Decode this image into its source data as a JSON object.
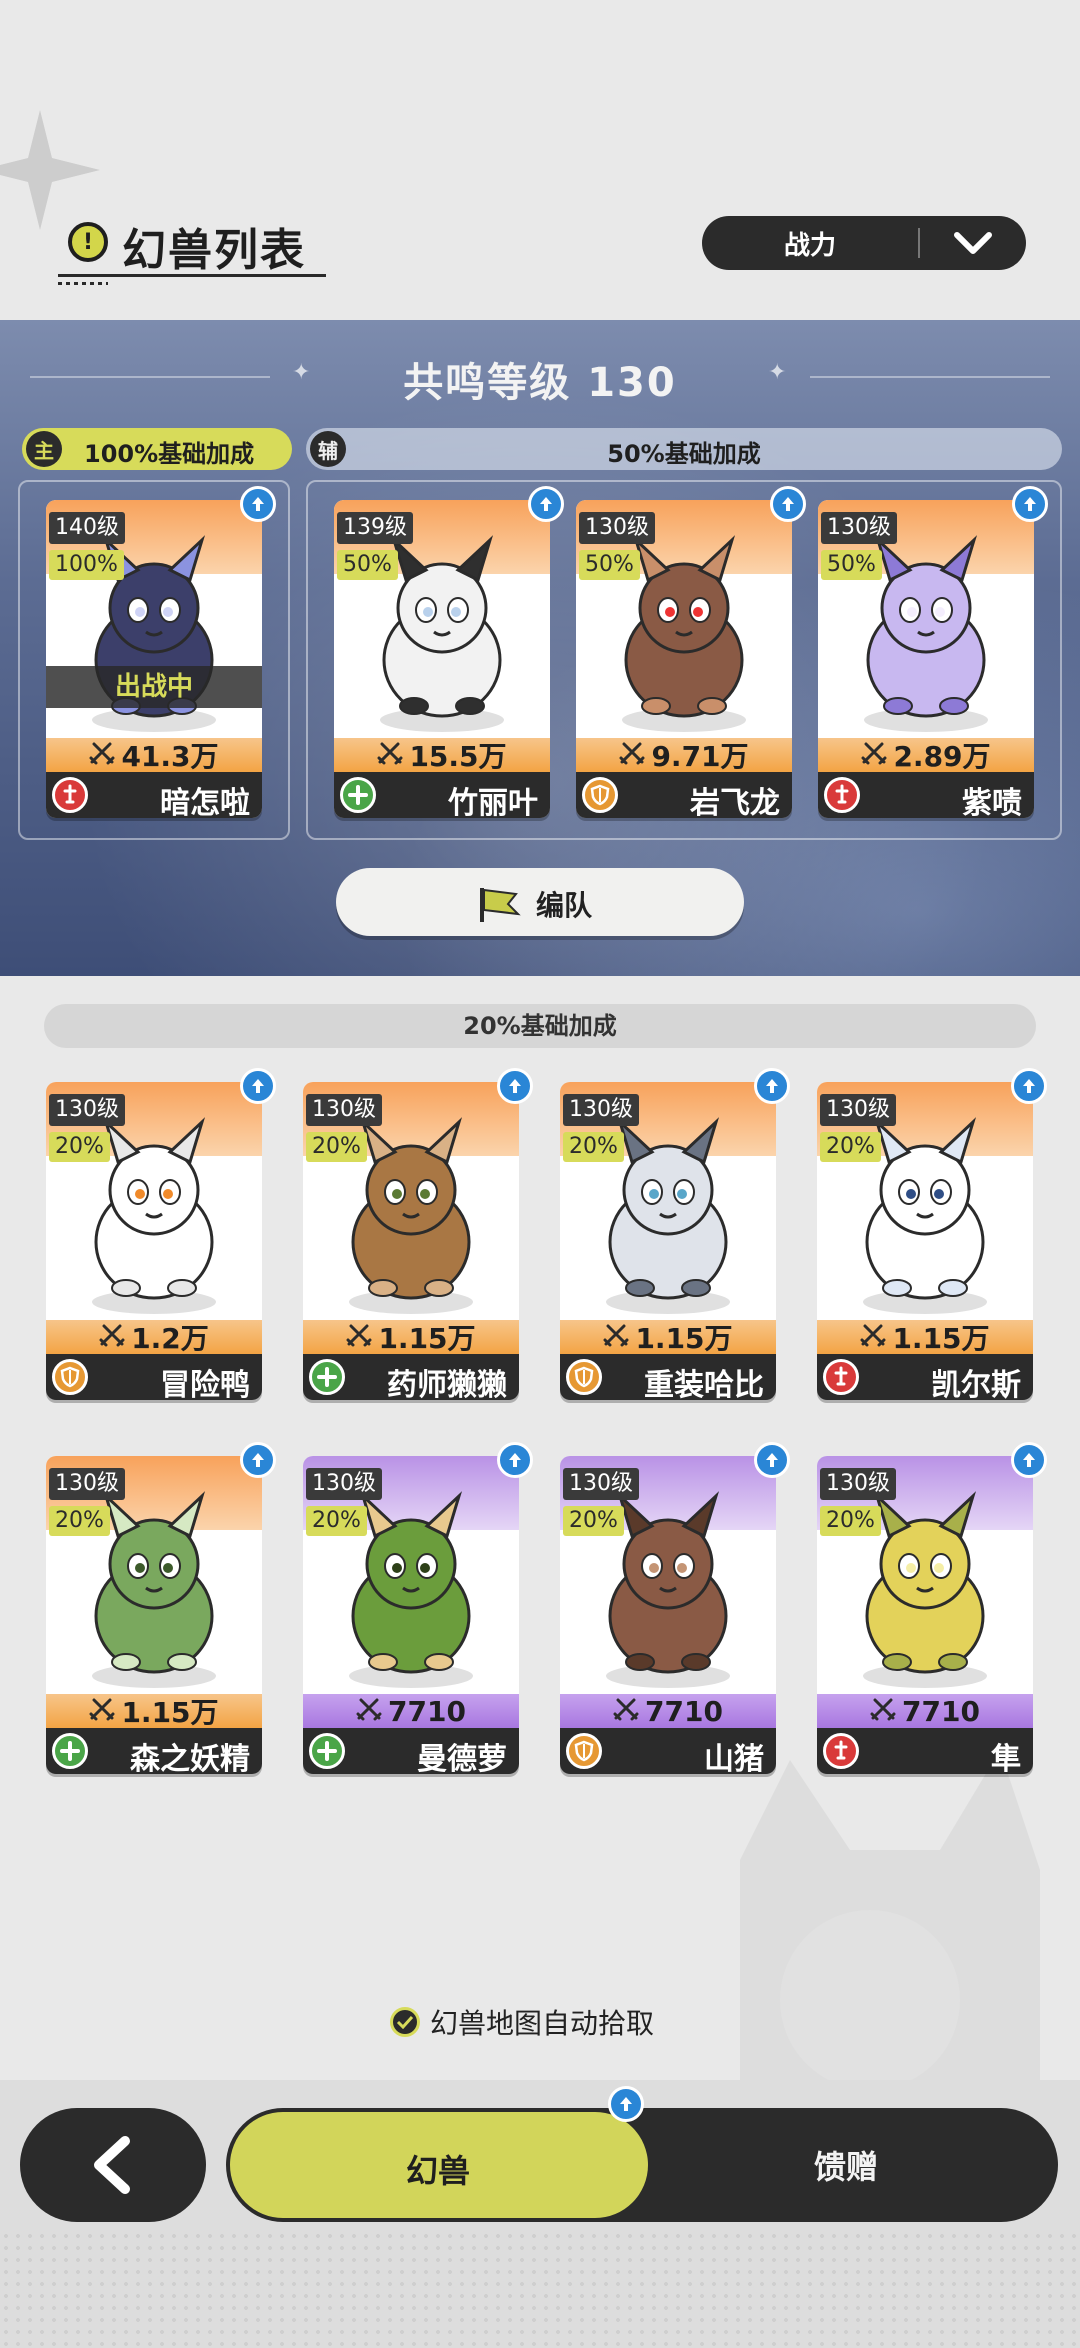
{
  "header": {
    "title": "幻兽列表",
    "sort_label": "战力"
  },
  "resonance": {
    "title": "共鸣等级 130",
    "main_badge": "主",
    "main_bonus": "100%基础加成",
    "support_badge": "辅",
    "support_bonus": "50%基础加成",
    "deploy_label": "编队"
  },
  "team_cards": [
    {
      "level": "140级",
      "pct": "100%",
      "power": "41.3万",
      "name": "暗怎啦",
      "role": "attack",
      "status": "出战中",
      "theme": "orange"
    },
    {
      "level": "139级",
      "pct": "50%",
      "power": "15.5万",
      "name": "竹丽叶",
      "role": "heal",
      "theme": "orange"
    },
    {
      "level": "130级",
      "pct": "50%",
      "power": "9.71万",
      "name": "岩飞龙",
      "role": "defense",
      "theme": "orange"
    },
    {
      "level": "130级",
      "pct": "50%",
      "power": "2.89万",
      "name": "紫啧",
      "role": "attack",
      "theme": "orange"
    }
  ],
  "reserve_section": {
    "bonus": "20%基础加成"
  },
  "reserve_cards": [
    {
      "level": "130级",
      "pct": "20%",
      "power": "1.2万",
      "name": "冒险鸭",
      "role": "defense",
      "theme": "orange"
    },
    {
      "level": "130级",
      "pct": "20%",
      "power": "1.15万",
      "name": "药师獭獭",
      "role": "heal",
      "theme": "orange"
    },
    {
      "level": "130级",
      "pct": "20%",
      "power": "1.15万",
      "name": "重装哈比",
      "role": "defense",
      "theme": "orange"
    },
    {
      "level": "130级",
      "pct": "20%",
      "power": "1.15万",
      "name": "凯尔斯",
      "role": "attack",
      "theme": "orange"
    },
    {
      "level": "130级",
      "pct": "20%",
      "power": "1.15万",
      "name": "森之妖精",
      "role": "heal",
      "theme": "orange"
    },
    {
      "level": "130级",
      "pct": "20%",
      "power": "7710",
      "name": "曼德萝",
      "role": "heal",
      "theme": "purple"
    },
    {
      "level": "130级",
      "pct": "20%",
      "power": "7710",
      "name": "山猪",
      "role": "defense",
      "theme": "purple"
    },
    {
      "level": "130级",
      "pct": "20%",
      "power": "7710",
      "name": "隼",
      "role": "attack",
      "theme": "purple"
    }
  ],
  "auto_pickup": {
    "label": "幻兽地图自动拾取",
    "checked": true
  },
  "tabs": [
    {
      "label": "幻兽",
      "active": true
    },
    {
      "label": "馈赠",
      "active": false
    }
  ]
}
